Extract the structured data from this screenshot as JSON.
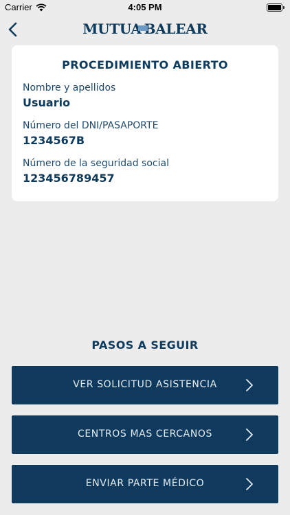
{
  "status_bar": {
    "carrier": "Carrier",
    "time": "4:05 PM",
    "wifi_icon": "wifi-icon",
    "battery_icon": "battery-icon"
  },
  "nav": {
    "back_icon": "chevron-left-icon",
    "logo_left": "MUTUA",
    "logo_right": "BALEAR"
  },
  "card": {
    "title": "PROCEDIMIENTO ABIERTO",
    "fields": [
      {
        "label": "Nombre y apellidos",
        "value": "Usuario"
      },
      {
        "label": "Número del DNI/PASAPORTE",
        "value": "1234567B"
      },
      {
        "label": "Número de la seguridad social",
        "value": "123456789457"
      }
    ]
  },
  "steps": {
    "title": "PASOS A SEGUIR",
    "buttons": [
      {
        "label": "VER SOLICITUD ASISTENCIA",
        "icon": "chevron-right-icon"
      },
      {
        "label": "CENTROS MAS CERCANOS",
        "icon": "chevron-right-icon"
      },
      {
        "label": "ENVIAR PARTE MÉDICO",
        "icon": "chevron-right-icon"
      }
    ]
  },
  "colors": {
    "primary": "#0f3a5d",
    "background": "#ececec",
    "card": "#ffffff",
    "button_text": "#e3ebf2"
  }
}
